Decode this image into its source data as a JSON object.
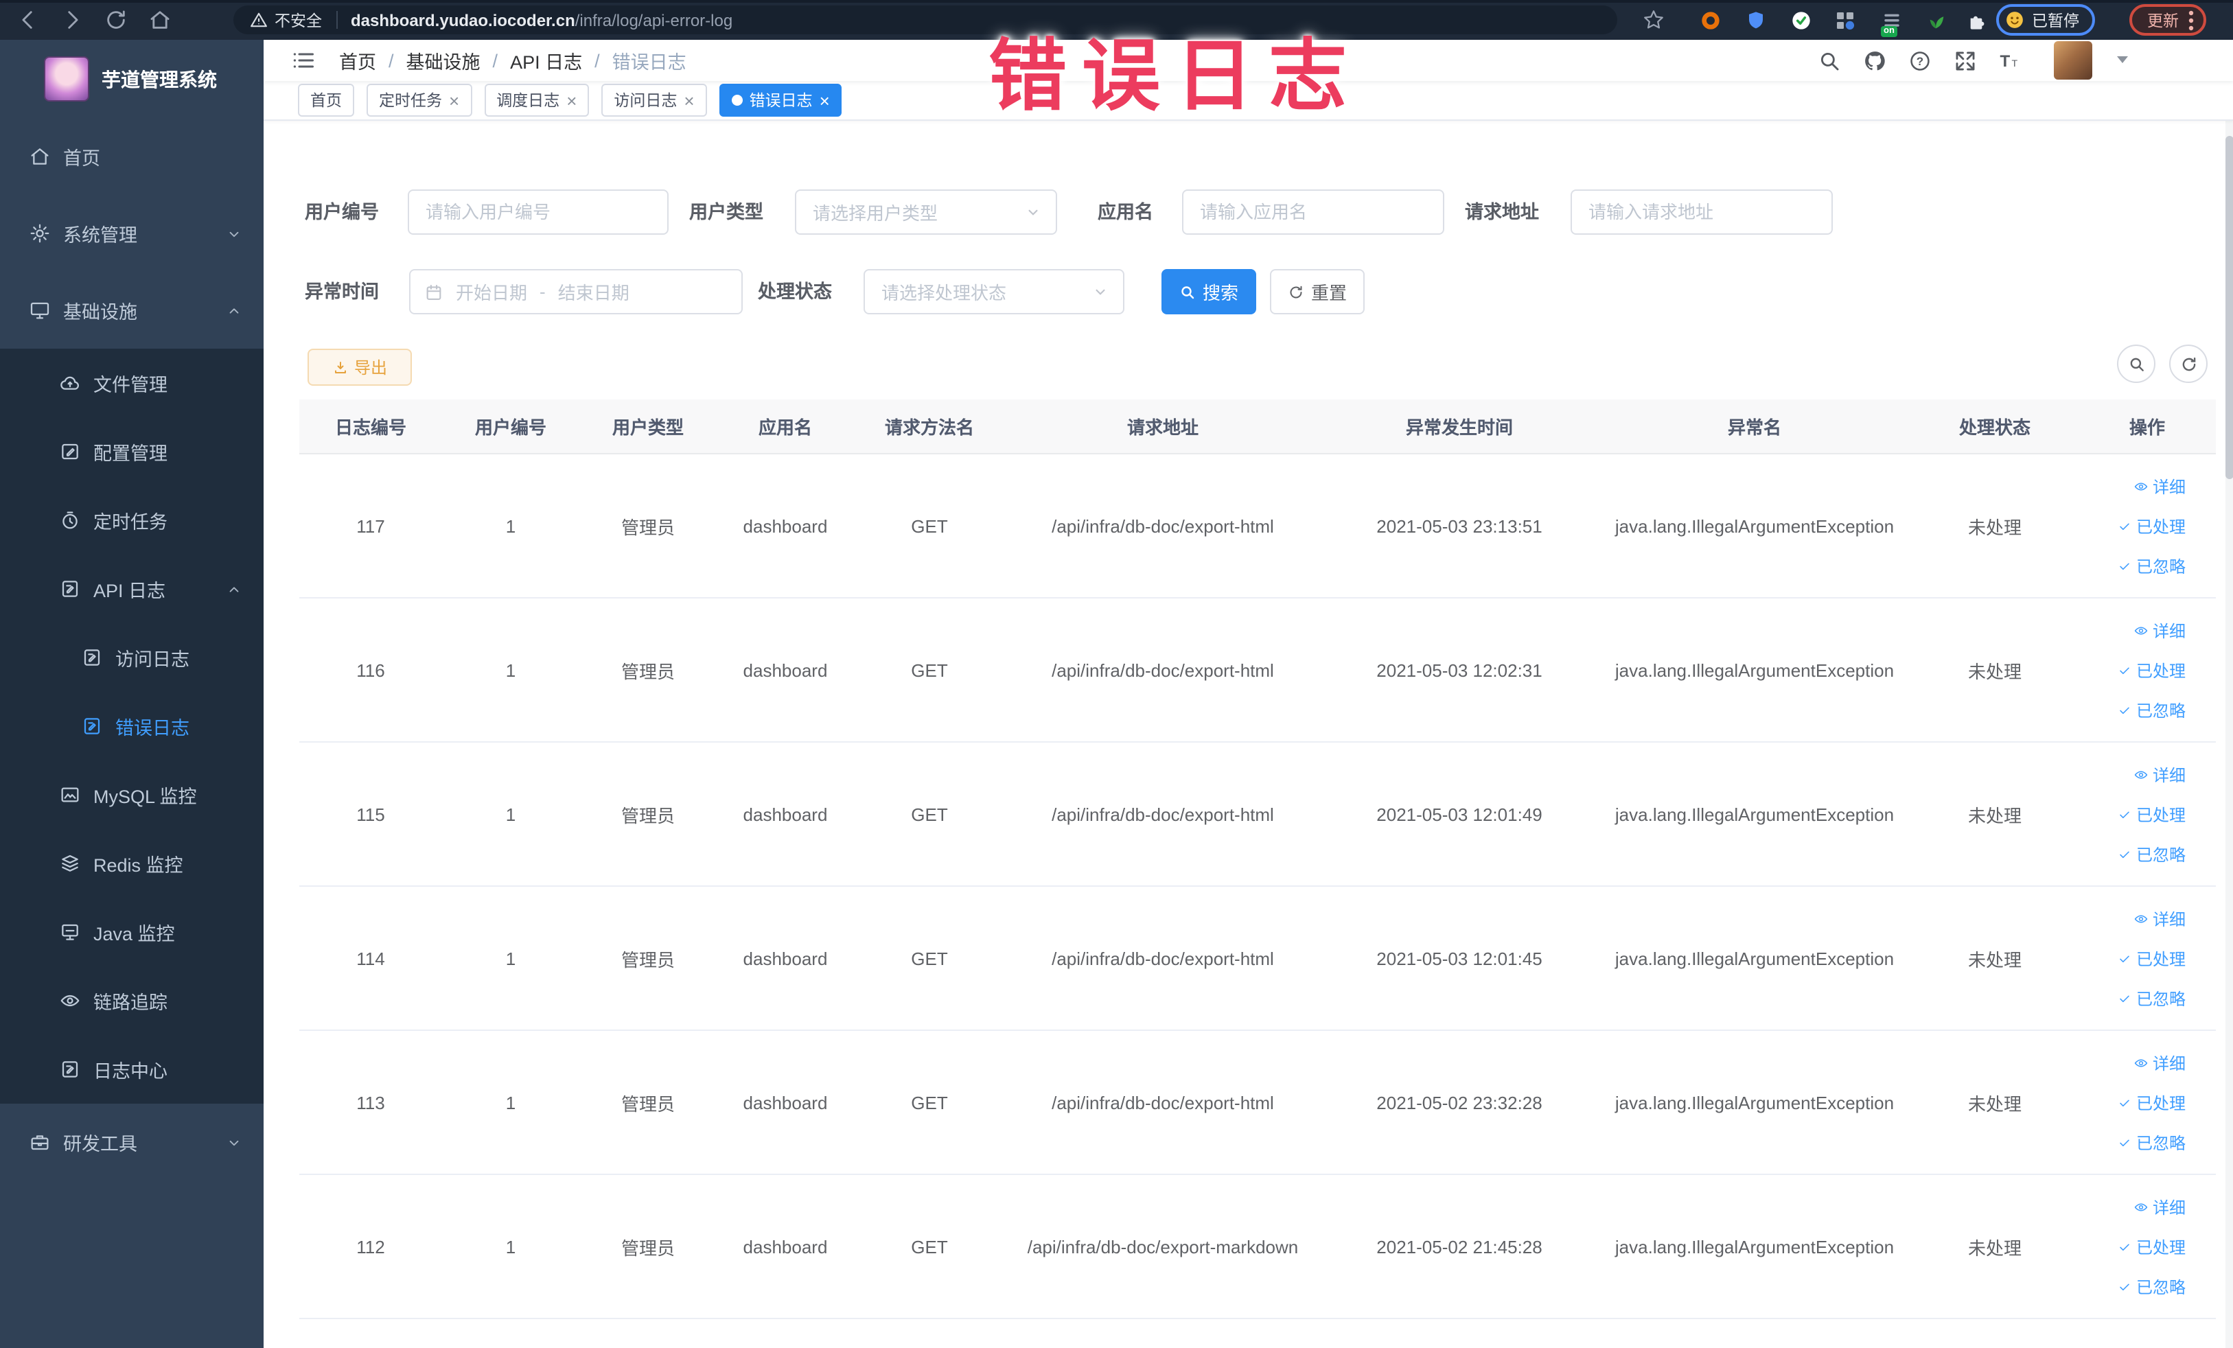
{
  "browser": {
    "security_label": "不安全",
    "url_domain": "dashboard.yudao.iocoder.cn",
    "url_path": "/infra/log/api-error-log",
    "extension_badge": "on",
    "profile_label": "已暂停",
    "update_label": "更新"
  },
  "watermark": "错误日志",
  "sidebar": {
    "logo_title": "芋道管理系统",
    "items": [
      {
        "name": "sidebar-item-home",
        "label": "首页",
        "icon": "home-icon",
        "level": 1,
        "sub": false
      },
      {
        "name": "sidebar-item-system-management",
        "label": "系统管理",
        "icon": "gear-icon",
        "level": 1,
        "sub": false,
        "chevron": "down"
      },
      {
        "name": "sidebar-item-infrastructure",
        "label": "基础设施",
        "icon": "infrastructure-icon",
        "level": 1,
        "sub": false,
        "chevron": "up"
      },
      {
        "name": "sidebar-item-file-management",
        "label": "文件管理",
        "icon": "file-upload-icon",
        "level": 2,
        "sub": true
      },
      {
        "name": "sidebar-item-config-management",
        "label": "配置管理",
        "icon": "config-icon",
        "level": 2,
        "sub": true
      },
      {
        "name": "sidebar-item-scheduled-tasks",
        "label": "定时任务",
        "icon": "timer-icon",
        "level": 2,
        "sub": true
      },
      {
        "name": "sidebar-item-api-logs",
        "label": "API 日志",
        "icon": "api-log-icon",
        "level": 2,
        "sub": true,
        "chevron": "up"
      },
      {
        "name": "sidebar-item-access-logs",
        "label": "访问日志",
        "icon": "access-log-icon",
        "level": 3,
        "sub": true
      },
      {
        "name": "sidebar-item-error-logs",
        "label": "错误日志",
        "icon": "error-log-icon",
        "level": 3,
        "sub": true,
        "active": true
      },
      {
        "name": "sidebar-item-mysql-monitor",
        "label": "MySQL 监控",
        "icon": "mysql-icon",
        "level": 2,
        "sub": true
      },
      {
        "name": "sidebar-item-redis-monitor",
        "label": "Redis 监控",
        "icon": "redis-icon",
        "level": 2,
        "sub": true
      },
      {
        "name": "sidebar-item-java-monitor",
        "label": "Java 监控",
        "icon": "java-icon",
        "level": 2,
        "sub": true
      },
      {
        "name": "sidebar-item-trace",
        "label": "链路追踪",
        "icon": "trace-icon",
        "level": 2,
        "sub": true
      },
      {
        "name": "sidebar-item-log-center",
        "label": "日志中心",
        "icon": "log-center-icon",
        "level": 2,
        "sub": true
      },
      {
        "name": "sidebar-item-devtools",
        "label": "研发工具",
        "icon": "devtools-icon",
        "level": 1,
        "sub": false,
        "chevron": "down"
      }
    ]
  },
  "header": {
    "breadcrumb": [
      "首页",
      "基础设施",
      "API 日志",
      "错误日志"
    ],
    "breadcrumb_separator": "/"
  },
  "tabs": [
    {
      "name": "tab-home",
      "label": "首页",
      "closable": false,
      "active": false
    },
    {
      "name": "tab-scheduled-tasks",
      "label": "定时任务",
      "closable": true,
      "active": false
    },
    {
      "name": "tab-schedule-logs",
      "label": "调度日志",
      "closable": true,
      "active": false
    },
    {
      "name": "tab-access-logs",
      "label": "访问日志",
      "closable": true,
      "active": false
    },
    {
      "name": "tab-error-logs",
      "label": "错误日志",
      "closable": true,
      "active": true
    }
  ],
  "filters": {
    "user_id_label": "用户编号",
    "user_id_placeholder": "请输入用户编号",
    "user_type_label": "用户类型",
    "user_type_placeholder": "请选择用户类型",
    "app_name_label": "应用名",
    "app_name_placeholder": "请输入应用名",
    "request_url_label": "请求地址",
    "request_url_placeholder": "请输入请求地址",
    "exception_time_label": "异常时间",
    "start_date_placeholder": "开始日期",
    "date_separator": "-",
    "end_date_placeholder": "结束日期",
    "process_status_label": "处理状态",
    "process_status_placeholder": "请选择处理状态",
    "search_label": "搜索",
    "reset_label": "重置"
  },
  "toolbar": {
    "export_label": "导出"
  },
  "table": {
    "columns": [
      "日志编号",
      "用户编号",
      "用户类型",
      "应用名",
      "请求方法名",
      "请求地址",
      "异常发生时间",
      "异常名",
      "处理状态",
      "操作"
    ],
    "rows": [
      {
        "log_id": "117",
        "user_id": "1",
        "user_type": "管理员",
        "app_name": "dashboard",
        "method": "GET",
        "url": "/api/infra/db-doc/export-html",
        "time": "2021-05-03 23:13:51",
        "exception": "java.lang.IllegalArgumentException",
        "status": "未处理"
      },
      {
        "log_id": "116",
        "user_id": "1",
        "user_type": "管理员",
        "app_name": "dashboard",
        "method": "GET",
        "url": "/api/infra/db-doc/export-html",
        "time": "2021-05-03 12:02:31",
        "exception": "java.lang.IllegalArgumentException",
        "status": "未处理"
      },
      {
        "log_id": "115",
        "user_id": "1",
        "user_type": "管理员",
        "app_name": "dashboard",
        "method": "GET",
        "url": "/api/infra/db-doc/export-html",
        "time": "2021-05-03 12:01:49",
        "exception": "java.lang.IllegalArgumentException",
        "status": "未处理"
      },
      {
        "log_id": "114",
        "user_id": "1",
        "user_type": "管理员",
        "app_name": "dashboard",
        "method": "GET",
        "url": "/api/infra/db-doc/export-html",
        "time": "2021-05-03 12:01:45",
        "exception": "java.lang.IllegalArgumentException",
        "status": "未处理"
      },
      {
        "log_id": "113",
        "user_id": "1",
        "user_type": "管理员",
        "app_name": "dashboard",
        "method": "GET",
        "url": "/api/infra/db-doc/export-html",
        "time": "2021-05-02 23:32:28",
        "exception": "java.lang.IllegalArgumentException",
        "status": "未处理"
      },
      {
        "log_id": "112",
        "user_id": "1",
        "user_type": "管理员",
        "app_name": "dashboard",
        "method": "GET",
        "url": "/api/infra/db-doc/export-markdown",
        "time": "2021-05-02 21:45:28",
        "exception": "java.lang.IllegalArgumentException",
        "status": "未处理"
      }
    ],
    "row_actions": [
      {
        "name": "detail-link",
        "label": "详细",
        "icon": "eye-icon"
      },
      {
        "name": "processed-link",
        "label": "已处理",
        "icon": "check-icon"
      },
      {
        "name": "ignored-link",
        "label": "已忽略",
        "icon": "check-icon"
      }
    ]
  }
}
